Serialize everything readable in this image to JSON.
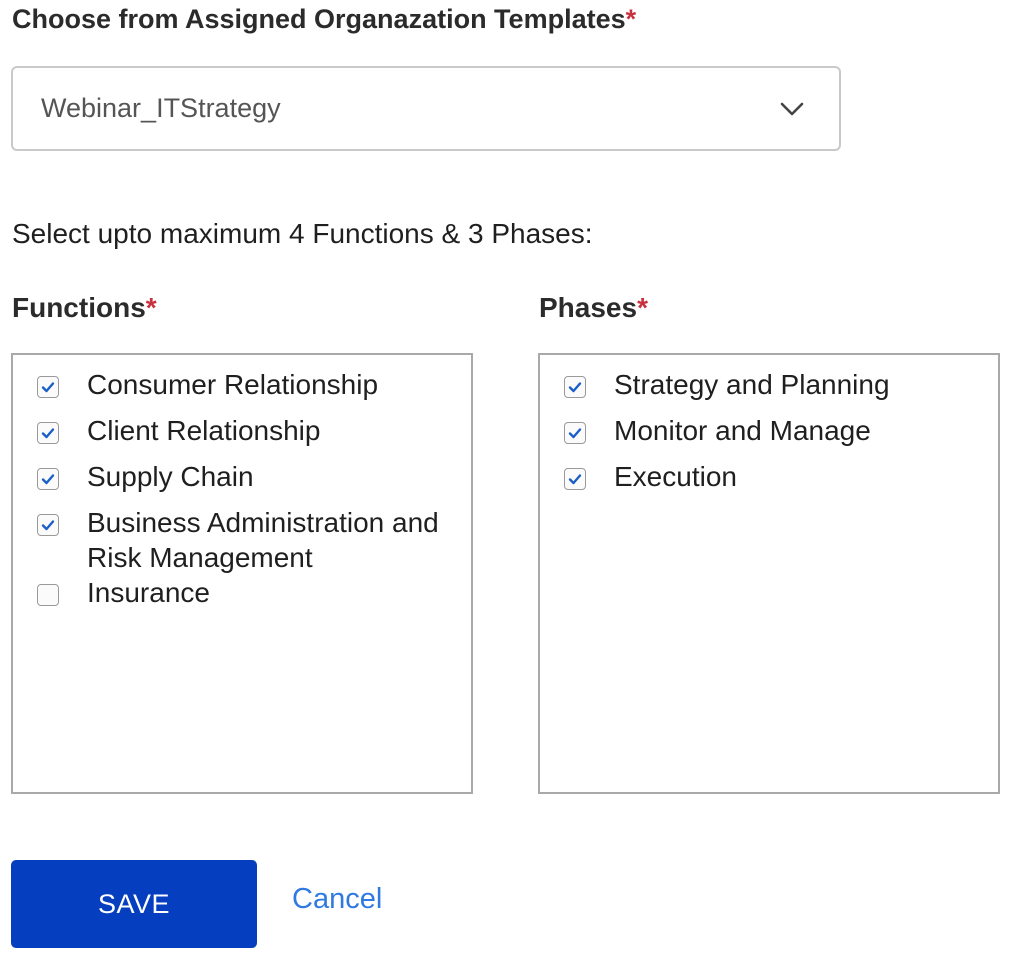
{
  "template": {
    "label": "Choose from Assigned Organazation Templates",
    "required_mark": "*",
    "selected_value": "Webinar_ITStrategy",
    "chevron_icon": "chevron-down-icon"
  },
  "instructions": "Select upto maximum 4 Functions & 3 Phases:",
  "functions": {
    "label": "Functions",
    "required_mark": "*",
    "items": [
      {
        "label": "Consumer Relationship",
        "checked": true
      },
      {
        "label": "Client Relationship",
        "checked": true
      },
      {
        "label": "Supply Chain",
        "checked": true
      },
      {
        "label": "Business Administration and Risk Management",
        "checked": true
      },
      {
        "label": "Insurance",
        "checked": false
      }
    ]
  },
  "phases": {
    "label": "Phases",
    "required_mark": "*",
    "items": [
      {
        "label": "Strategy and Planning",
        "checked": true
      },
      {
        "label": "Monitor and Manage",
        "checked": true
      },
      {
        "label": "Execution",
        "checked": true
      }
    ]
  },
  "actions": {
    "save_label": "SAVE",
    "cancel_label": "Cancel"
  },
  "colors": {
    "required": "#c8313e",
    "primary_button": "#063ec0",
    "link": "#2f7ae0",
    "check": "#1a5fc9"
  }
}
